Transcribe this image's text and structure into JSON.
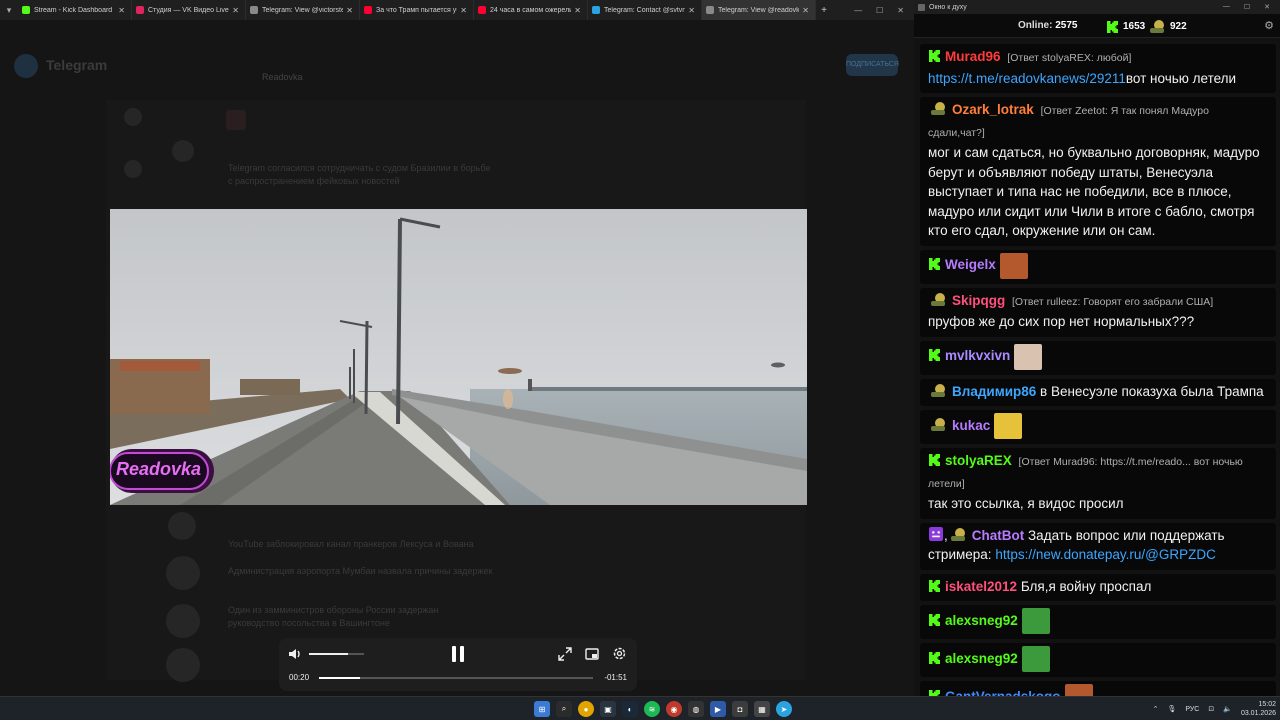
{
  "browser": {
    "tabs": [
      {
        "title": "Stream - Kick Dashboard",
        "color": "#53fc18"
      },
      {
        "title": "Студия — VK Видео Live",
        "color": "#e0245e"
      },
      {
        "title": "Telegram: View @victorstep",
        "color": "#8a8a8a"
      },
      {
        "title": "За что Трамп пытается уб",
        "color": "#ff0033"
      },
      {
        "title": "24 часа в самом ожерели",
        "color": "#ff0033"
      },
      {
        "title": "Telegram: Contact @svtvnew",
        "color": "#2aa4e0"
      },
      {
        "title": "Telegram: View @readovka",
        "color": "#8a8a8a",
        "active": true
      }
    ],
    "new_tab": "+",
    "background": {
      "telegram_label": "Telegram",
      "channel_title": "Readovka",
      "join_label": "ПОДПИСАТЬСЯ",
      "post_text_1": "Telegram согласился сотрудничать с судом Бразилии в борьбе",
      "post_text_2": "с распространением фейковых новостей",
      "post_text_3": "YouTube заблокировал канал пранкеров Лексуса и Вована",
      "post_text_4": "Администрация аэропорта Мумбаи назвала причины задержек",
      "post_text_5": "Один из замминистров обороны России задержан",
      "post_text_6": "руководство посольства в Вашингтоне"
    }
  },
  "video": {
    "watermark": "Readovka"
  },
  "player": {
    "current_time": "00:20",
    "remaining_time": "-01:51",
    "progress": 0.15,
    "volume": 0.7,
    "icons": [
      "volume-icon",
      "pause-icon",
      "fullscreen-icon",
      "pip-icon",
      "settings-icon"
    ]
  },
  "chat_window": {
    "title": "Окно к духу",
    "online_label": "Online:",
    "online_count": "2575",
    "kick_count": "1653",
    "other_count": "922",
    "messages": [
      {
        "platform": "kick",
        "user": "Murad96",
        "color": "#ff3b3b",
        "reply": "[Ответ stolyaREX: любой]",
        "link": "https://t.me/readovkanews/29211",
        "text": "вот ночью летели"
      },
      {
        "platform": "vk",
        "user": "Ozark_lotrak",
        "color": "#ff7f3b",
        "reply": "[Ответ Zeetot: Я так понял Мадуро сдали,чат?]",
        "text": "мог и сам сдаться, но буквально договорняк, мадуро берут и объявляют победу штаты, Венесуэла выступает и типа нас не победили, все в плюсе, мадуро или сидит или Чили в итоге с бабло, смотря кто его сдал, окружение или он сам."
      },
      {
        "platform": "kick",
        "user": "Weigelx",
        "color": "#b77bff",
        "emote": "laugh"
      },
      {
        "platform": "vk",
        "user": "Skipqgg",
        "color": "#ff4f7b",
        "reply": "[Ответ rulleez: Говорят его забрали США]",
        "text": "пруфов же до сих пор нет нормальных???"
      },
      {
        "platform": "kick",
        "user": "mvlkvxivn",
        "color": "#a98bff",
        "emote": "cat"
      },
      {
        "platform": "vk",
        "user": "Владимир86",
        "color": "#3ea6ff",
        "text": "в Венесуэле показуха была Трампа"
      },
      {
        "platform": "vk",
        "user": "kukac",
        "color": "#b77bff",
        "emote": "cry"
      },
      {
        "platform": "kick",
        "user": "stolyaREX",
        "color": "#53fc18",
        "reply": "[Ответ Murad96: https://t.me/reado... вот ночью летели]",
        "text": "так это ссылка, я видос просил"
      },
      {
        "platform": "bot",
        "user": "ChatBot",
        "color": "#b77bff",
        "text": "Задать вопрос или поддержать стримера:",
        "link": "https://new.donatepay.ru/@GRPZDC"
      },
      {
        "platform": "kick",
        "user": "iskatel2012",
        "color": "#ff4f7b",
        "text": "Бля,я войну проспал"
      },
      {
        "platform": "kick",
        "user": "alexsneg92",
        "color": "#53fc18",
        "emote": "pepe"
      },
      {
        "platform": "kick",
        "user": "alexsneg92",
        "color": "#53fc18",
        "emote": "pepe"
      },
      {
        "platform": "kick",
        "user": "GantVernadskogo",
        "color": "#3e8bff",
        "emote": "laugh"
      }
    ]
  },
  "taskbar": {
    "lang": "РУС",
    "time": "15:02",
    "date": "03.01.2026"
  }
}
